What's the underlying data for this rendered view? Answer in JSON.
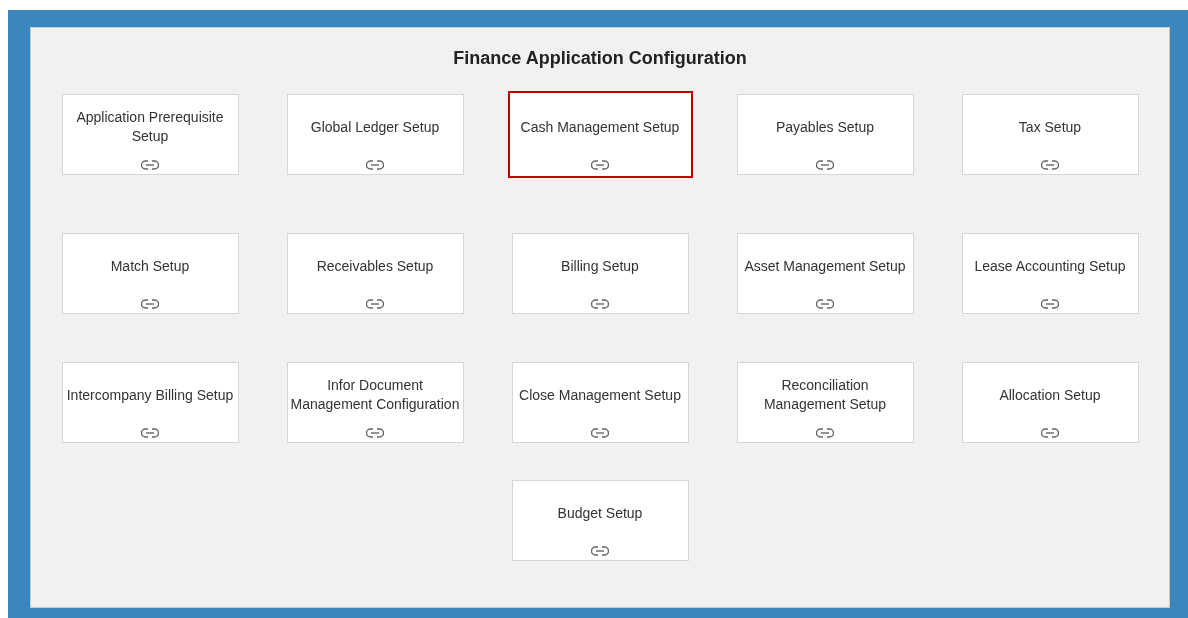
{
  "title": "Finance Application Configuration",
  "rows": [
    [
      {
        "label": "Application Prerequisite Setup",
        "selected": false
      },
      {
        "label": "Global Ledger Setup",
        "selected": false
      },
      {
        "label": "Cash Management Setup",
        "selected": true
      },
      {
        "label": "Payables Setup",
        "selected": false
      },
      {
        "label": "Tax Setup",
        "selected": false
      }
    ],
    [
      {
        "label": "Match Setup",
        "selected": false
      },
      {
        "label": "Receivables Setup",
        "selected": false
      },
      {
        "label": "Billing Setup",
        "selected": false
      },
      {
        "label": "Asset Management Setup",
        "selected": false
      },
      {
        "label": "Lease Accounting Setup",
        "selected": false
      }
    ],
    [
      {
        "label": "Intercompany Billing Setup",
        "selected": false
      },
      {
        "label": "Infor Document Management Configuration",
        "selected": false
      },
      {
        "label": "Close Management Setup",
        "selected": false
      },
      {
        "label": "Reconciliation Management Setup",
        "selected": false
      },
      {
        "label": "Allocation Setup",
        "selected": false
      }
    ],
    [
      {
        "label": "Budget Setup",
        "selected": false
      }
    ]
  ]
}
